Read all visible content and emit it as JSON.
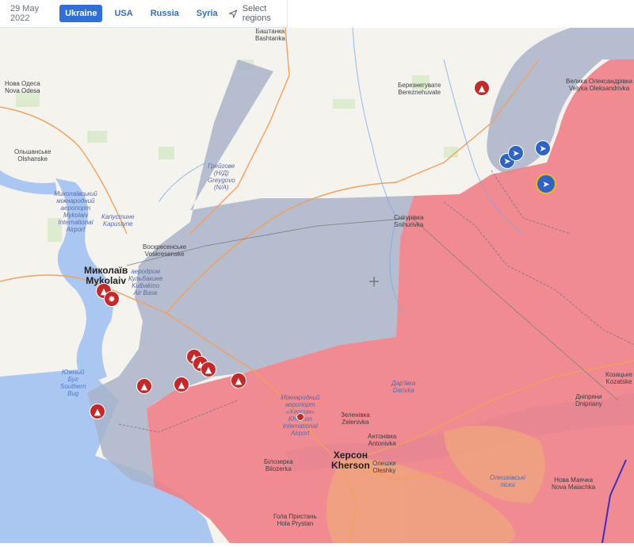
{
  "topbar": {
    "date": "29 May 2022",
    "tabs": [
      {
        "label": "Ukraine",
        "active": true
      },
      {
        "label": "USA",
        "active": false
      },
      {
        "label": "Russia",
        "active": false
      },
      {
        "label": "Syria",
        "active": false
      }
    ],
    "select_label": "Select regions",
    "select_icon": "navigation-arrow-icon"
  },
  "colors": {
    "russian_control": "#ee7f86",
    "contested": "#a9b3c9",
    "water": "#a9c7f0",
    "land": "#f4f3ee",
    "accent": "#2f6fd6",
    "marker_red": "#c62828",
    "marker_blue": "#2f64c6",
    "marker_highlight_ring": "#f1b81d"
  },
  "labels": {
    "bashtanka": "Баштанка\nBashtanka",
    "nova_odesa": "Нова Одеса\nNova Odesa",
    "bereznehuvate": "Березнегувате\nBereznehuvate",
    "velyka_oleksandrivka": "Велика Олександрівка\nVelyka Oleksandrivka",
    "olshanske": "Ольшанське\nOlshanske",
    "greygovo": "Грейгове\n(Н/Д)\nGreygovo\n(N/A)",
    "mykolaiv_airport": "Миколаївський\nміжнародний\nаеропорт\nMykolaiv\nInternational\nAirport",
    "kapustyne": "Капустине\nKapustyne",
    "voskresenske": "Воскресенське\nVoskresenske",
    "snihurivka": "Снігурівка\nSnihurivka",
    "mykolaiv": "Миколаїв\nMykolaiv",
    "kulbakino": "аеродром\nКульбакине\nKulbakino\nAir Base",
    "southern_bug": "Южный\nБуг\nSouthern\nBug",
    "kherson_airport": "Міжнародний\nаеропорт\n«Херсон»\nKherson\nInternational\nAirport",
    "zelenivka": "Зеленівка\nZelenivka",
    "darivka": "Дар'ївка\nDarivka",
    "kozatske": "Козацьке\nKozatske",
    "dnipriany": "Дніпряни\nDnipriany",
    "antonivka": "Антонівка\nAntonivka",
    "bilozerka": "Білозерка\nBilozerka",
    "kherson": "Херсон\nKherson",
    "oleshky": "Олешки\nOleshky",
    "oleshky_sands": "Олешківські\nпіски",
    "nova_maiachka": "Нова Маячка\nNova Maiachka",
    "hola_prystan": "Гола Пристань\nHola Prystan"
  },
  "markers": [
    {
      "kind": "bomb",
      "icon": "bomb-icon"
    },
    {
      "kind": "bomb",
      "icon": "bomb-icon"
    },
    {
      "kind": "explosion",
      "icon": "explosion-icon"
    },
    {
      "kind": "bomb",
      "icon": "bomb-icon"
    },
    {
      "kind": "bomb",
      "icon": "bomb-icon"
    },
    {
      "kind": "bomb",
      "icon": "bomb-icon"
    },
    {
      "kind": "bomb",
      "icon": "bomb-icon"
    },
    {
      "kind": "bomb",
      "icon": "bomb-icon"
    },
    {
      "kind": "bomb",
      "icon": "bomb-icon"
    },
    {
      "kind": "bomb",
      "icon": "bomb-icon"
    },
    {
      "kind": "airport",
      "icon": "airport-pin-icon"
    },
    {
      "kind": "rifle",
      "icon": "rifle-icon"
    },
    {
      "kind": "rifle",
      "icon": "rifle-icon"
    },
    {
      "kind": "rifle",
      "icon": "rifle-icon"
    },
    {
      "kind": "rifle",
      "icon": "rifle-icon",
      "highlighted": true
    }
  ]
}
